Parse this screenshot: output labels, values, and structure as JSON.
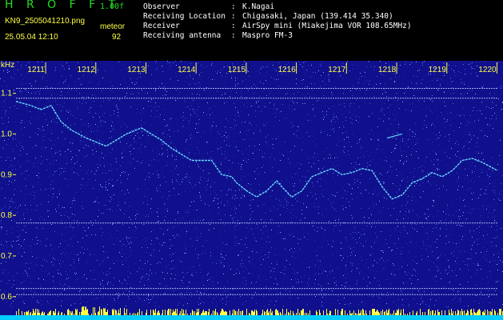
{
  "header": {
    "app_title": "H R O F F T",
    "app_version": "1.00f",
    "file_name": "KN9_2505041210.png",
    "datetime": "25.05.04 12:10",
    "meteor_label": "meteor",
    "meteor_count": "92"
  },
  "info": [
    {
      "key": "Observer",
      "value": "K.Nagai"
    },
    {
      "key": "Receiving Location",
      "value": "Chigasaki, Japan (139.414 35.340)"
    },
    {
      "key": "Receiver",
      "value": "AirSpy mini (Miakejima VOR 108.65MHz)"
    },
    {
      "key": "Receiving antenna",
      "value": "Maspro FM-3"
    }
  ],
  "colors": {
    "background": "#10108c",
    "label": "#ffff44",
    "title": "#22dd22",
    "trace": "#66d8ff",
    "grid_line": "#b8c8ff",
    "bottom_band": "#ffff44",
    "bottom_strip": "#00ccff"
  },
  "chart_data": {
    "type": "heatmap",
    "y_axis_unit": "kHz",
    "y_ticks": [
      "1.1",
      "1.0",
      "0.9",
      "0.8",
      "0.7",
      "0.6"
    ],
    "y_range": [
      0.57,
      1.18
    ],
    "x_ticks": [
      "1211",
      "1212",
      "1213",
      "1214",
      "1215",
      "1216",
      "1217",
      "1218",
      "1219",
      "1220"
    ],
    "x_range_minutes": [
      1210.6,
      1220.2
    ],
    "horizontal_lines_khz": [
      1.112,
      1.088,
      0.781,
      0.62,
      0.605
    ],
    "trace": {
      "x": [
        1210.6,
        1210.9,
        1211.1,
        1211.3,
        1211.5,
        1211.7,
        1212.0,
        1212.2,
        1212.4,
        1212.6,
        1212.8,
        1213.0,
        1213.1,
        1213.3,
        1213.5,
        1213.7,
        1213.9,
        1214.1,
        1214.3,
        1214.5,
        1214.7,
        1214.9,
        1215.0,
        1215.2,
        1215.4,
        1215.6,
        1215.8,
        1215.9,
        1216.1,
        1216.3,
        1216.5,
        1216.7,
        1216.9,
        1217.1,
        1217.3,
        1217.5,
        1217.7,
        1217.9,
        1218.1,
        1218.3,
        1218.5,
        1218.7,
        1218.9,
        1219.1,
        1219.3,
        1219.5,
        1219.7,
        1219.9,
        1220.2
      ],
      "khz": [
        1.08,
        1.07,
        1.06,
        1.07,
        1.03,
        1.01,
        0.99,
        0.98,
        0.97,
        0.985,
        1.0,
        1.01,
        1.015,
        1.0,
        0.985,
        0.965,
        0.95,
        0.935,
        0.935,
        0.935,
        0.9,
        0.895,
        0.88,
        0.86,
        0.845,
        0.86,
        0.885,
        0.87,
        0.845,
        0.86,
        0.895,
        0.905,
        0.915,
        0.9,
        0.905,
        0.915,
        0.91,
        0.87,
        0.84,
        0.85,
        0.88,
        0.89,
        0.905,
        0.895,
        0.91,
        0.935,
        0.94,
        0.93,
        0.91
      ]
    }
  }
}
